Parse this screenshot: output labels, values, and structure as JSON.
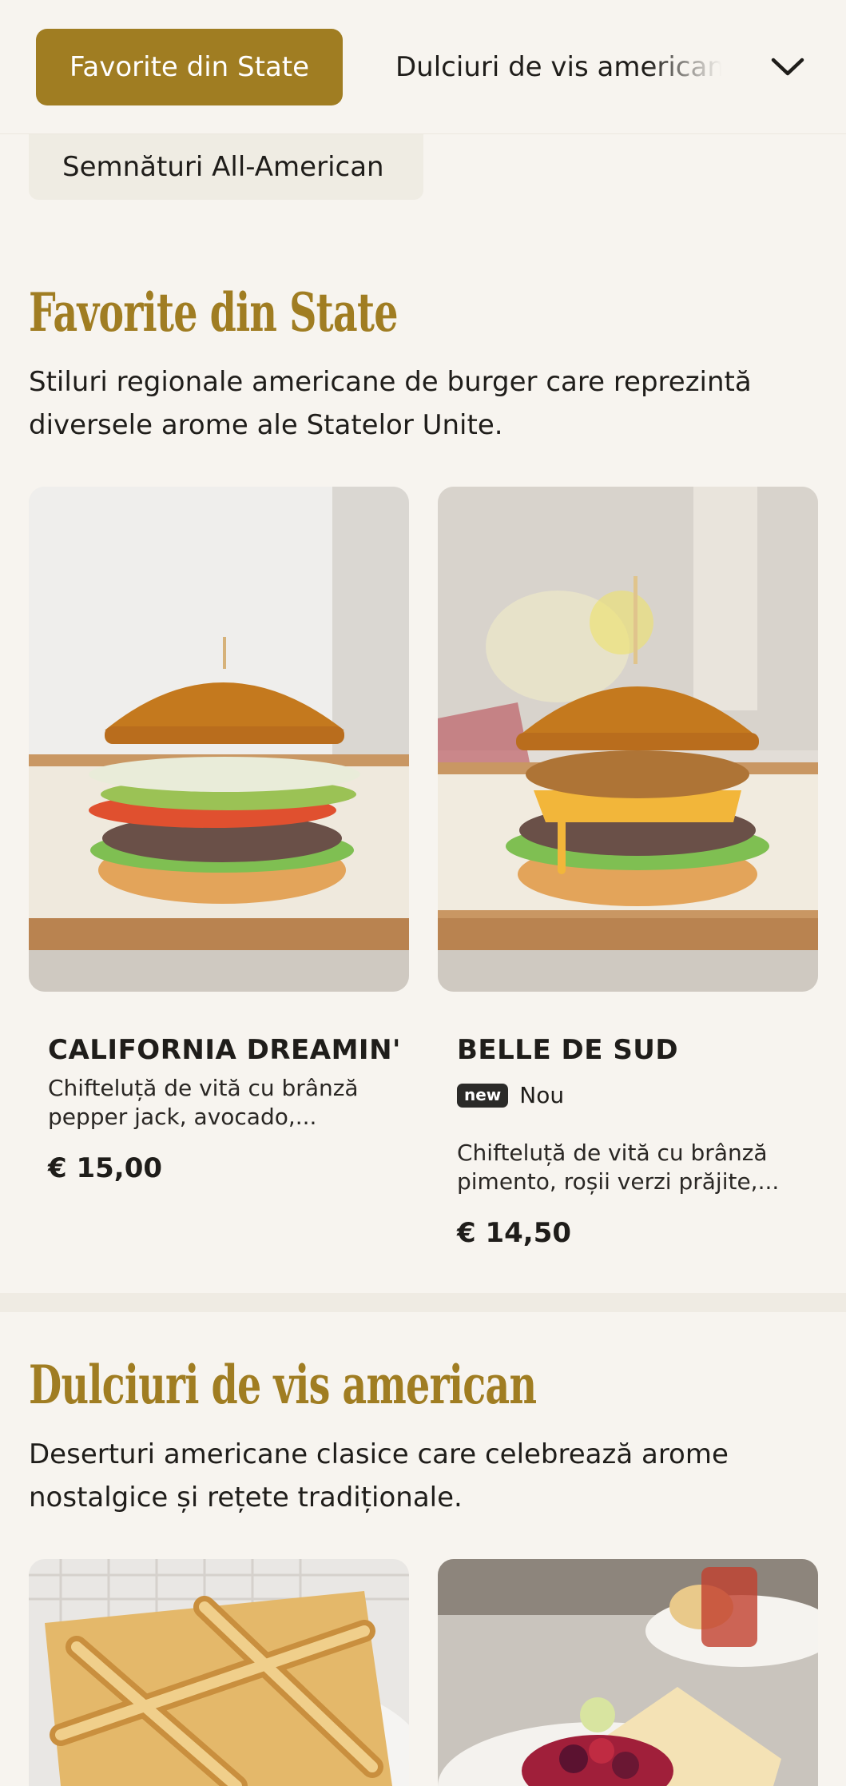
{
  "category_nav": {
    "active": "Favorite din State",
    "next": "Dulciuri de vis american",
    "second_row": "Semnături All-American",
    "expand_icon": "chevron-down-icon"
  },
  "sections": [
    {
      "title": "Favorite din State",
      "description": "Stiluri regionale americane de burger care reprezintă diversele arome ale Statelor Unite.",
      "items": [
        {
          "name": "CALIFORNIA DREAMIN'",
          "description": "Chifteluță de vită cu brânză pepper jack, avocado,...",
          "price": "€ 15,00"
        },
        {
          "name": "BELLE DE SUD",
          "badge": "new",
          "badge_label": "Nou",
          "description": "Chifteluță de vită cu brânză pimento, roșii verzi prăjite,...",
          "price": "€ 14,50"
        }
      ]
    },
    {
      "title": "Dulciuri de vis american",
      "description": "Deserturi americane clasice care celebrează arome nostalgice și rețete tradiționale."
    }
  ],
  "colors": {
    "accent": "#a07d22",
    "background": "#f7f4ef",
    "chip": "#efece3"
  }
}
